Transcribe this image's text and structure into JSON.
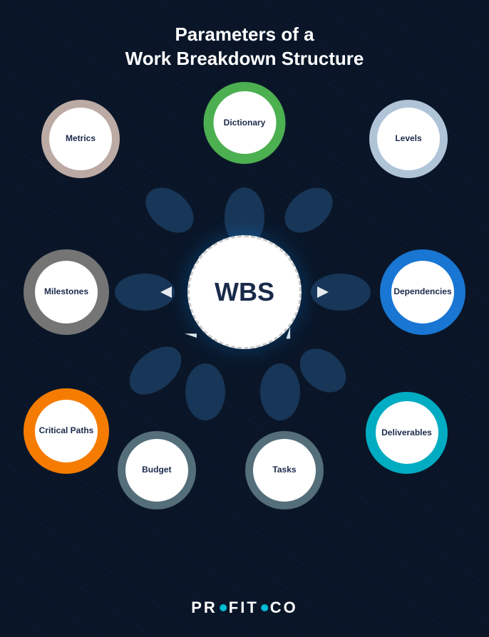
{
  "title": {
    "line1": "Parameters of a",
    "line2": "Work Breakdown Structure"
  },
  "center": {
    "label": "WBS"
  },
  "nodes": [
    {
      "id": "dictionary",
      "label": "Dictionary",
      "color": "#4caf50",
      "angle": 90
    },
    {
      "id": "levels",
      "label": "Levels",
      "color": "#b0c4d8",
      "angle": 45
    },
    {
      "id": "dependencies",
      "label": "Dependencies",
      "color": "#2196f3",
      "angle": 0
    },
    {
      "id": "deliverables",
      "label": "Deliverables",
      "color": "#26c6da",
      "angle": 315
    },
    {
      "id": "tasks",
      "label": "Tasks",
      "color": "#78909c",
      "angle": 270
    },
    {
      "id": "budget",
      "label": "Budget",
      "color": "#78909c",
      "angle": 225
    },
    {
      "id": "critical-paths",
      "label": "Critical Paths",
      "color": "#ff9800",
      "angle": 180
    },
    {
      "id": "milestones",
      "label": "Milestones",
      "color": "#9e9e9e",
      "angle": 135
    },
    {
      "id": "metrics",
      "label": "Metrics",
      "color": "#c8b59a",
      "angle": 120
    }
  ],
  "logo": {
    "text": "PROFIT.CO"
  }
}
